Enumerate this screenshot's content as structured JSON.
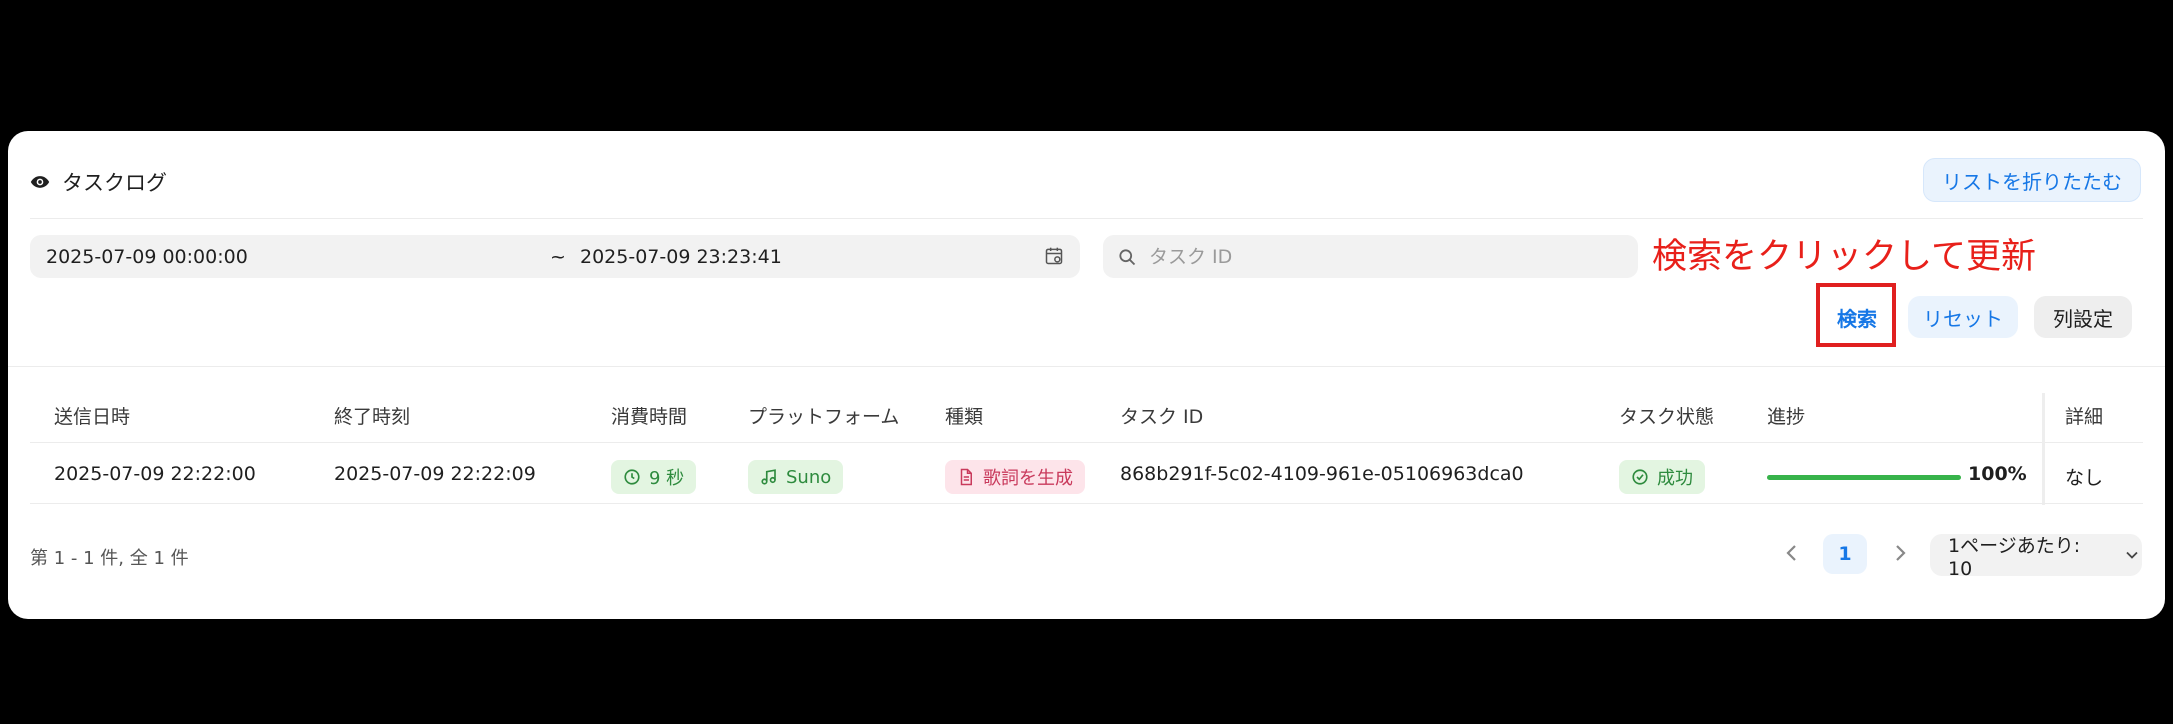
{
  "header": {
    "title": "タスクログ",
    "collapse_label": "リストを折りたたむ"
  },
  "filters": {
    "range_start": "2025-07-09 00:00:00",
    "range_separator": "~",
    "range_end": "2025-07-09 23:23:41",
    "search_placeholder": "タスク ID"
  },
  "annotation": "検索をクリックして更新",
  "actions": {
    "search": "検索",
    "reset": "リセット",
    "columns": "列設定"
  },
  "table": {
    "columns": [
      "送信日時",
      "終了時刻",
      "消費時間",
      "プラットフォーム",
      "種類",
      "タスク ID",
      "タスク状態",
      "進捗",
      "詳細"
    ],
    "rows": [
      {
        "submitted": "2025-07-09 22:22:00",
        "finished": "2025-07-09 22:22:09",
        "duration": "9 秒",
        "platform": "Suno",
        "type": "歌詞を生成",
        "task_id": "868b291f-5c02-4109-961e-05106963dca0",
        "status": "成功",
        "progress": 100,
        "progress_label": "100%",
        "detail": "なし"
      }
    ]
  },
  "footer": {
    "summary": "第 1 - 1 件,  全 1 件",
    "current_page": "1",
    "page_size": "1ページあたり: 10"
  },
  "colors": {
    "accent": "#1677e6",
    "success": "#37b34a",
    "annotation": "#e8201a"
  }
}
